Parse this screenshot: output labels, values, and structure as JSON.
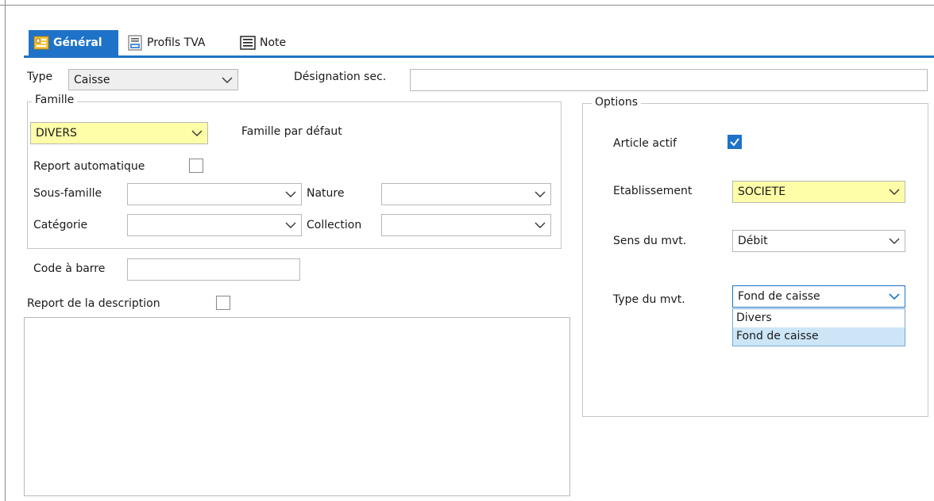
{
  "tabs": [
    {
      "label": "Général",
      "icon": "form-icon"
    },
    {
      "label": "Profils TVA",
      "icon": "tva-document-icon"
    },
    {
      "label": "Note",
      "icon": "note-icon"
    }
  ],
  "general": {
    "type_label": "Type",
    "type_value": "Caisse",
    "designation_label": "Désignation sec.",
    "designation_value": ""
  },
  "famille": {
    "group_title": "Famille",
    "value": "DIVERS",
    "default_label": "Famille par défaut",
    "report_auto_label": "Report automatique",
    "report_auto_checked": false,
    "sous_famille_label": "Sous-famille",
    "sous_famille_value": "",
    "nature_label": "Nature",
    "nature_value": "",
    "categorie_label": "Catégorie",
    "categorie_value": "",
    "collection_label": "Collection",
    "collection_value": ""
  },
  "code_barre": {
    "label": "Code à barre",
    "value": ""
  },
  "report_description": {
    "label": "Report de la description",
    "checked": false,
    "text": ""
  },
  "options": {
    "group_title": "Options",
    "article_actif_label": "Article actif",
    "article_actif_checked": true,
    "etablissement_label": "Etablissement",
    "etablissement_value": "SOCIETE",
    "sens_label": "Sens du mvt.",
    "sens_value": "Débit",
    "type_mvt_label": "Type du mvt.",
    "type_mvt_value": "Fond de caisse",
    "type_mvt_options": [
      "Divers",
      "Fond de caisse"
    ],
    "type_mvt_selected": "Fond de caisse"
  },
  "colors": {
    "accent": "#1e73c8",
    "highlight_field": "#fefea8",
    "selected_option": "#cde6f7"
  }
}
